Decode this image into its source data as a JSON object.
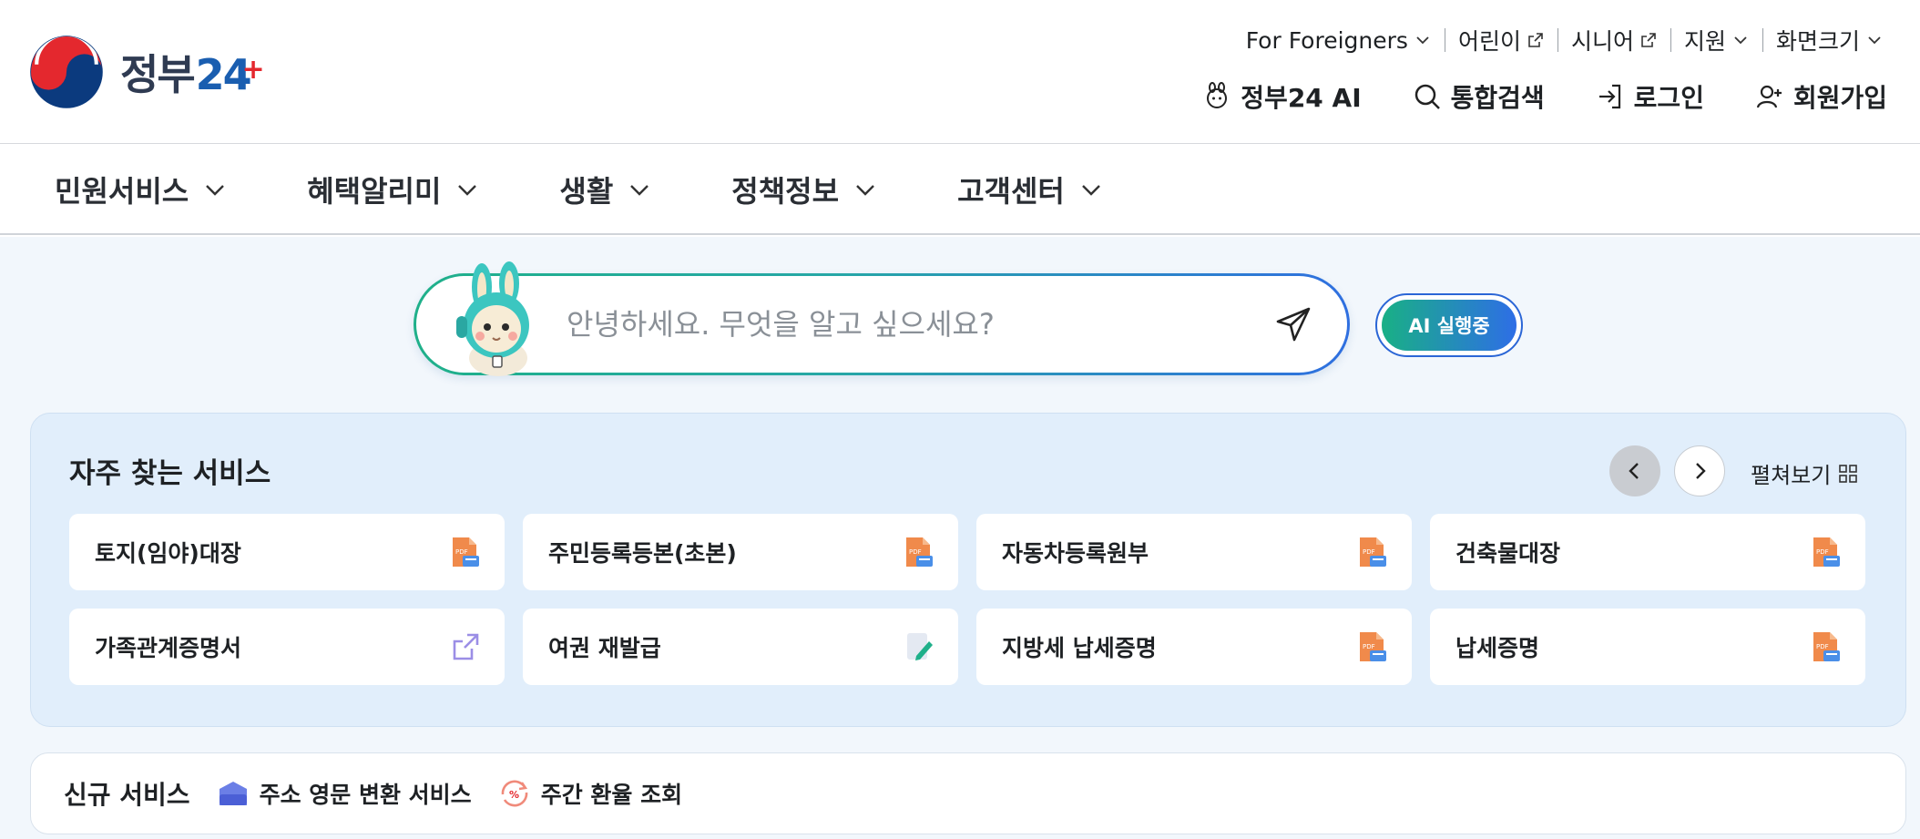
{
  "logo": {
    "text": "정부",
    "num": "24",
    "plus": "+"
  },
  "utility": [
    {
      "label": "For Foreigners",
      "icon": "chevron-down-icon"
    },
    {
      "label": "어린이",
      "icon": "external-link-icon"
    },
    {
      "label": "시니어",
      "icon": "external-link-icon"
    },
    {
      "label": "지원",
      "icon": "chevron-down-icon"
    },
    {
      "label": "화면크기",
      "icon": "chevron-down-icon"
    }
  ],
  "actions": [
    {
      "label": "정부24 AI",
      "icon": "mascot-icon"
    },
    {
      "label": "통합검색",
      "icon": "search-icon"
    },
    {
      "label": "로그인",
      "icon": "login-icon"
    },
    {
      "label": "회원가입",
      "icon": "user-plus-icon"
    }
  ],
  "nav": [
    "민원서비스",
    "혜택알리미",
    "생활",
    "정책정보",
    "고객센터"
  ],
  "search": {
    "placeholder": "안녕하세요. 무엇을 알고 싶으세요?"
  },
  "ai_button": "AI 실행중",
  "favorites": {
    "title": "자주 찾는 서비스",
    "expand_label": "펼쳐보기",
    "items": [
      {
        "label": "토지(임야)대장",
        "icon": "pdf-document-icon"
      },
      {
        "label": "주민등록등본(초본)",
        "icon": "pdf-document-icon"
      },
      {
        "label": "자동차등록원부",
        "icon": "pdf-document-icon"
      },
      {
        "label": "건축물대장",
        "icon": "pdf-document-icon"
      },
      {
        "label": "가족관계증명서",
        "icon": "external-link-icon"
      },
      {
        "label": "여권 재발급",
        "icon": "edit-document-icon"
      },
      {
        "label": "지방세 납세증명",
        "icon": "pdf-document-icon"
      },
      {
        "label": "납세증명",
        "icon": "pdf-document-icon"
      }
    ]
  },
  "new_services": {
    "title": "신규 서비스",
    "items": [
      {
        "label": "주소 영문 변환 서비스",
        "icon": "mailbox-icon"
      },
      {
        "label": "주간 환율 조회",
        "icon": "exchange-rate-icon"
      }
    ]
  },
  "colors": {
    "accent_blue": "#2f6fe0",
    "accent_green": "#1fb08a",
    "pdf_orange": "#f08a4b",
    "panel_bg": "#e1eefb",
    "page_bg": "#f2f7fc"
  }
}
